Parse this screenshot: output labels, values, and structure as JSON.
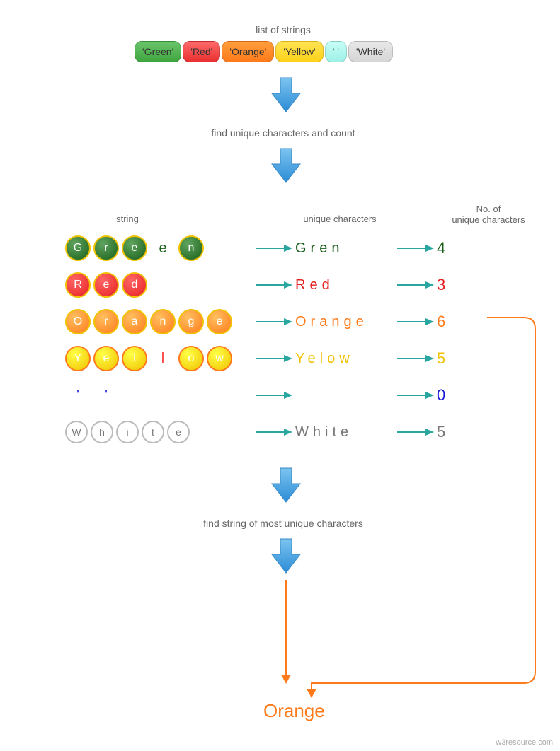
{
  "labels": {
    "title": "list of strings",
    "step1": "find unique characters and count",
    "step2": "find string of most unique characters",
    "col_string": "string",
    "col_unique": "unique characters",
    "col_count_l1": "No. of",
    "col_count_l2": "unique characters"
  },
  "pills": [
    {
      "text": "'Green'",
      "bg": "linear-gradient(#6ac46a,#3fa63f)"
    },
    {
      "text": "'Red'",
      "bg": "linear-gradient(#ff6a6a,#e93030)"
    },
    {
      "text": "'Orange'",
      "bg": "linear-gradient(#ff9e3d,#ff7a1a)"
    },
    {
      "text": "'Yellow'",
      "bg": "linear-gradient(#ffe352,#ffd21a)"
    },
    {
      "text": "' '",
      "bg": "linear-gradient(#c6fff6,#9ef0e7)"
    },
    {
      "text": "'White'",
      "bg": "linear-gradient(#e8e8e8,#d6d6d6)"
    }
  ],
  "rows": [
    {
      "circles": [
        {
          "ch": "G",
          "bg": "#195e19",
          "ring": "#f0c200",
          "fg": "#fff"
        },
        {
          "ch": "r",
          "bg": "#195e19",
          "ring": "#f0c200",
          "fg": "#fff"
        },
        {
          "ch": "e",
          "bg": "#195e19",
          "ring": "#f0c200",
          "fg": "#fff"
        },
        {
          "ch": "e",
          "bg": "none",
          "ring": "none",
          "fg": "#195e19"
        },
        {
          "ch": "n",
          "bg": "#195e19",
          "ring": "#f0c200",
          "fg": "#fff"
        }
      ],
      "unique": "Gren",
      "uniqueColor": "#195e19",
      "count": "4",
      "countColor": "#195e19"
    },
    {
      "circles": [
        {
          "ch": "R",
          "bg": "#e62020",
          "ring": "#f0c200",
          "fg": "#fff"
        },
        {
          "ch": "e",
          "bg": "#e62020",
          "ring": "#f0c200",
          "fg": "#fff"
        },
        {
          "ch": "d",
          "bg": "#e62020",
          "ring": "#f0c200",
          "fg": "#fff"
        }
      ],
      "unique": "Red",
      "uniqueColor": "#e62020",
      "count": "3",
      "countColor": "#e62020"
    },
    {
      "circles": [
        {
          "ch": "O",
          "bg": "#ff7a1a",
          "ring": "#f0c200",
          "fg": "#fff"
        },
        {
          "ch": "r",
          "bg": "#ff7a1a",
          "ring": "#f0c200",
          "fg": "#fff"
        },
        {
          "ch": "a",
          "bg": "#ff7a1a",
          "ring": "#f0c200",
          "fg": "#fff"
        },
        {
          "ch": "n",
          "bg": "#ff7a1a",
          "ring": "#f0c200",
          "fg": "#fff"
        },
        {
          "ch": "g",
          "bg": "#ff7a1a",
          "ring": "#f0c200",
          "fg": "#fff"
        },
        {
          "ch": "e",
          "bg": "#ff7a1a",
          "ring": "#f0c200",
          "fg": "#fff"
        }
      ],
      "unique": "Orange",
      "uniqueColor": "#ff7a1a",
      "count": "6",
      "countColor": "#ff7a1a"
    },
    {
      "circles": [
        {
          "ch": "Y",
          "bg": "#f0c200",
          "ring": "#ff7a1a",
          "fg": "#fff"
        },
        {
          "ch": "e",
          "bg": "#f0c200",
          "ring": "#ff7a1a",
          "fg": "#fff"
        },
        {
          "ch": "l",
          "bg": "#f0c200",
          "ring": "#ff7a1a",
          "fg": "#fff"
        },
        {
          "ch": "l",
          "bg": "none",
          "ring": "none",
          "fg": "#ff3a3a"
        },
        {
          "ch": "o",
          "bg": "#f0c200",
          "ring": "#ff7a1a",
          "fg": "#fff"
        },
        {
          "ch": "w",
          "bg": "#f0c200",
          "ring": "#ff7a1a",
          "fg": "#fff"
        }
      ],
      "unique": "Yelow",
      "uniqueColor": "#f0c200",
      "count": "5",
      "countColor": "#f0c200"
    },
    {
      "circles": [
        {
          "ch": "'",
          "bg": "none",
          "ring": "none",
          "fg": "#1a1add"
        },
        {
          "ch": "'",
          "bg": "none",
          "ring": "none",
          "fg": "#1a1add"
        }
      ],
      "unique": "",
      "uniqueColor": "#1a1add",
      "count": "0",
      "countColor": "#1a1add"
    },
    {
      "circles": [
        {
          "ch": "W",
          "bg": "hollow",
          "ring": "#bbb",
          "fg": "#777"
        },
        {
          "ch": "h",
          "bg": "hollow",
          "ring": "#bbb",
          "fg": "#777"
        },
        {
          "ch": "i",
          "bg": "hollow",
          "ring": "#bbb",
          "fg": "#777"
        },
        {
          "ch": "t",
          "bg": "hollow",
          "ring": "#bbb",
          "fg": "#777"
        },
        {
          "ch": "e",
          "bg": "hollow",
          "ring": "#bbb",
          "fg": "#777"
        }
      ],
      "unique": "White",
      "uniqueColor": "#777",
      "count": "5",
      "countColor": "#777"
    }
  ],
  "result": "Orange",
  "footer": "w3resource.com",
  "colors": {
    "arrowBlue": "#4fa8e8",
    "arrowTeal": "#2aa6a0",
    "connector": "#ff7a1a"
  }
}
